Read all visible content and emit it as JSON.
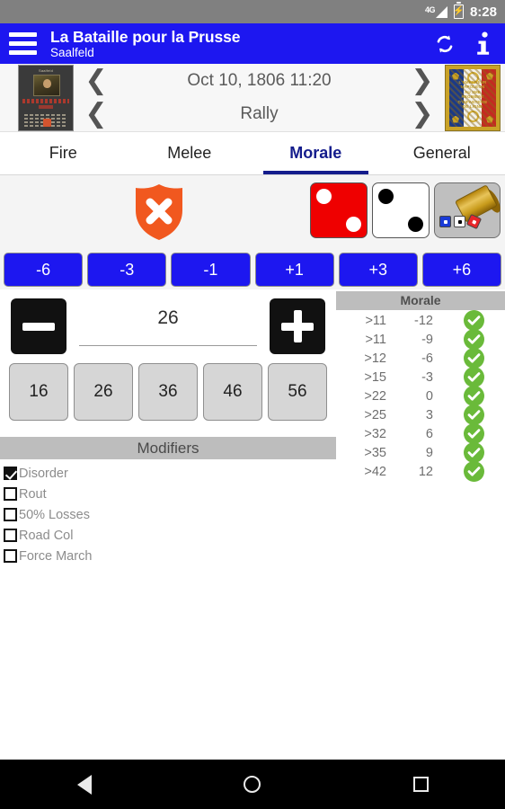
{
  "status_bar": {
    "network": "4G",
    "time": "8:28",
    "battery_icon": "battery-charging-icon"
  },
  "app_bar": {
    "menu_icon": "hamburger-menu-icon",
    "title": "La Bataille pour la Prusse",
    "subtitle": "Saalfeld",
    "refresh_icon": "refresh-icon",
    "info_icon": "info-icon"
  },
  "scenario_nav": {
    "left_thumb_label": "scenario-card-thumbnail",
    "right_thumb_label": "french-regimental-flag",
    "prev_icon": "chevron-left-icon",
    "next_icon": "chevron-right-icon",
    "date": "Oct 10, 1806 11:20",
    "phase": "Rally"
  },
  "tabs": [
    {
      "label": "Fire",
      "active": false
    },
    {
      "label": "Melee",
      "active": false
    },
    {
      "label": "Morale",
      "active": true
    },
    {
      "label": "General",
      "active": false
    }
  ],
  "result_row": {
    "shield_icon": "shield-fail-icon",
    "shield_color": "#f1581f",
    "dice": [
      {
        "name": "red-die",
        "value": 2,
        "face_color": "#ef0000",
        "pip_color": "#ffffff"
      },
      {
        "name": "white-die",
        "value": 2,
        "face_color": "#ffffff",
        "pip_color": "#000000"
      }
    ],
    "roll_button_icon": "dice-cup-icon"
  },
  "modifier_buttons": [
    {
      "label": "-6"
    },
    {
      "label": "-3"
    },
    {
      "label": "-1"
    },
    {
      "label": "+1"
    },
    {
      "label": "+3"
    },
    {
      "label": "+6"
    }
  ],
  "stepper": {
    "minus_icon": "minus-icon",
    "plus_icon": "plus-icon",
    "value": "26"
  },
  "quick_values": [
    {
      "label": "16"
    },
    {
      "label": "26"
    },
    {
      "label": "36"
    },
    {
      "label": "46"
    },
    {
      "label": "56"
    }
  ],
  "modifiers": {
    "header": "Modifiers",
    "items": [
      {
        "label": "Disorder",
        "checked": true
      },
      {
        "label": "Rout",
        "checked": false
      },
      {
        "label": "50% Losses",
        "checked": false
      },
      {
        "label": "Road Col",
        "checked": false
      },
      {
        "label": "Force March",
        "checked": false
      }
    ]
  },
  "morale_table": {
    "header": "Morale",
    "check_color": "#6aba3a",
    "rows": [
      {
        "threshold": ">11",
        "modifier": "-12",
        "status": "check"
      },
      {
        "threshold": ">11",
        "modifier": "-9",
        "status": "check"
      },
      {
        "threshold": ">12",
        "modifier": "-6",
        "status": "check"
      },
      {
        "threshold": ">15",
        "modifier": "-3",
        "status": "check"
      },
      {
        "threshold": ">22",
        "modifier": "0",
        "status": "check"
      },
      {
        "threshold": ">25",
        "modifier": "3",
        "status": "check"
      },
      {
        "threshold": ">32",
        "modifier": "6",
        "status": "check"
      },
      {
        "threshold": ">35",
        "modifier": "9",
        "status": "check"
      },
      {
        "threshold": ">42",
        "modifier": "12",
        "status": "check"
      }
    ]
  },
  "system_nav": {
    "back_icon": "back-triangle-icon",
    "home_icon": "home-circle-icon",
    "recents_icon": "recents-square-icon"
  },
  "flag_text": "L'EMPEREUR NAPOLEON AU 2ME REGIMENT D'INFANTERIE DE LIGNE"
}
